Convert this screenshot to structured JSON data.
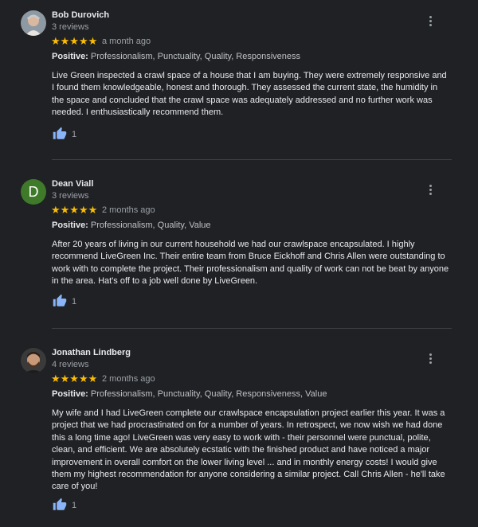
{
  "reviews": [
    {
      "name": "Bob Durovich",
      "reviews_count": "3 reviews",
      "stars": "★★★★★",
      "date": "a month ago",
      "positive_label": "Positive:",
      "positive_text": "Professionalism, Punctuality, Quality, Responsiveness",
      "text": "Live Green inspected a crawl space of a house that I am buying. They were extremely responsive and I found them knowledgeable, honest and thorough. They assessed the current state, the humidity in the space and concluded that the crawl space was adequately addressed and no further work was needed. I enthusiastically recommend them.",
      "likes": "1"
    },
    {
      "name": "Dean Viall",
      "avatar_letter": "D",
      "reviews_count": "3 reviews",
      "stars": "★★★★★",
      "date": "2 months ago",
      "positive_label": "Positive:",
      "positive_text": "Professionalism, Quality, Value",
      "text": "After 20 years of living in our current household we had our crawlspace encapsulated.  I highly recommend LiveGreen Inc.  Their entire team from Bruce Eickhoff and Chris Allen were outstanding to work with to complete the project.  Their professionalism and quality of work can not be beat by anyone in the area.  Hat's off to a job well done by LiveGreen.",
      "likes": "1"
    },
    {
      "name": "Jonathan Lindberg",
      "reviews_count": "4 reviews",
      "stars": "★★★★★",
      "date": "2 months ago",
      "positive_label": "Positive:",
      "positive_text": "Professionalism, Punctuality, Quality, Responsiveness, Value",
      "text": "My wife and I had LiveGreen complete our crawlspace encapsulation project earlier this year.  It was a project that we had procrastinated on for a number of years.  In retrospect, we now wish we had done this a long time ago!  LiveGreen was very easy to work with - their personnel were punctual, polite, clean, and efficient.  We are absolutely ecstatic with the finished product and have noticed a major improvement in overall comfort on the lower living level ... and in monthly energy costs!   I would give them my highest recommendation for anyone considering a similar project.  Call Chris Allen - he'll take care of you!",
      "likes": "1"
    }
  ],
  "colors": {
    "background": "#202124",
    "star": "#fbbc04",
    "thumb": "#8ab4f8",
    "avatar_d": "#3e7a2a"
  }
}
